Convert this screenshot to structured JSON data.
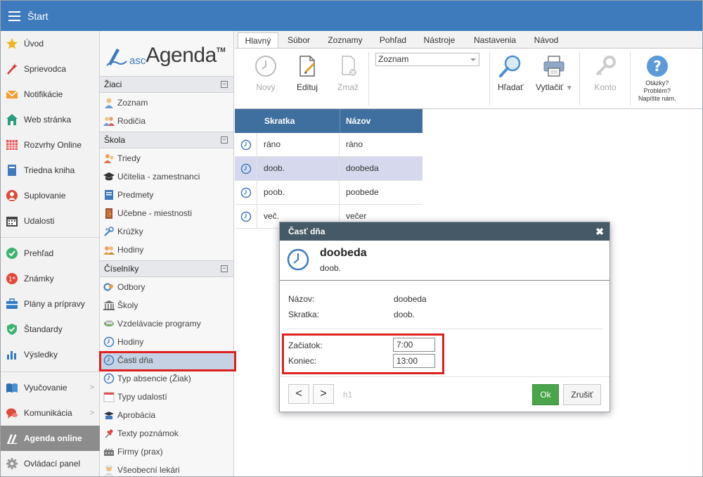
{
  "topbar": {
    "title": "Štart"
  },
  "leftnav": {
    "items": [
      {
        "label": "Úvod",
        "icon": "star-icon"
      },
      {
        "label": "Sprievodca",
        "icon": "wand-icon"
      },
      {
        "label": "Notifikácie",
        "icon": "envelope-icon"
      },
      {
        "label": "Web stránka",
        "icon": "house-icon"
      },
      {
        "label": "Rozvrhy Online",
        "icon": "timetable-icon"
      },
      {
        "label": "Triedna kniha",
        "icon": "book-icon"
      },
      {
        "label": "Suplovanie",
        "icon": "person-icon"
      },
      {
        "label": "Udalosti",
        "icon": "calendar-icon"
      },
      {
        "label": "Prehľad",
        "icon": "check-circle-icon"
      },
      {
        "label": "Známky",
        "icon": "grade-icon"
      },
      {
        "label": "Plány a prípravy",
        "icon": "briefcase-icon"
      },
      {
        "label": "Štandardy",
        "icon": "shield-icon"
      },
      {
        "label": "Výsledky",
        "icon": "bar-chart-icon"
      },
      {
        "label": "Vyučovanie",
        "icon": "open-book-icon"
      },
      {
        "label": "Komunikácia",
        "icon": "chat-icon"
      },
      {
        "label": "Agenda online",
        "icon": "agenda-icon"
      },
      {
        "label": "Ovládací panel",
        "icon": "gear-icon"
      }
    ]
  },
  "logo": {
    "asc": "asc",
    "agenda": "Agenda",
    "tm": "TM"
  },
  "tree": {
    "sections": [
      {
        "title": "Žiaci",
        "items": [
          {
            "label": "Zoznam",
            "icon": "student-icon"
          },
          {
            "label": "Rodičia",
            "icon": "parents-icon"
          }
        ]
      },
      {
        "title": "Škola",
        "items": [
          {
            "label": "Triedy",
            "icon": "class-icon"
          },
          {
            "label": "Učitelia - zamestnanci",
            "icon": "graduation-cap-icon"
          },
          {
            "label": "Predmety",
            "icon": "subject-icon"
          },
          {
            "label": "Učebne - miestnosti",
            "icon": "door-icon"
          },
          {
            "label": "Krúžky",
            "icon": "club-icon"
          },
          {
            "label": "Hodiny",
            "icon": "lessons-icon"
          }
        ]
      },
      {
        "title": "Číselníky",
        "items": [
          {
            "label": "Odbory",
            "icon": "fields-icon"
          },
          {
            "label": "Školy",
            "icon": "school-building-icon"
          },
          {
            "label": "Vzdelávacie programy",
            "icon": "program-icon"
          },
          {
            "label": "Hodiny",
            "icon": "clock-icon"
          },
          {
            "label": "Časti dňa",
            "icon": "clock-icon"
          },
          {
            "label": "Typ absencie (Žiak)",
            "icon": "clock-icon"
          },
          {
            "label": "Typy udalostí",
            "icon": "calendar-icon"
          },
          {
            "label": "Aprobácia",
            "icon": "qualification-icon"
          },
          {
            "label": "Texty poznámok",
            "icon": "pin-icon"
          },
          {
            "label": "Firmy (prax)",
            "icon": "company-icon"
          },
          {
            "label": "Všeobecní lekári",
            "icon": "doctor-icon"
          }
        ]
      }
    ],
    "collapse_symbol": "−"
  },
  "ribbon": {
    "tabs": [
      "Hlavný",
      "Súbor",
      "Zoznamy",
      "Pohľad",
      "Nástroje",
      "Nastavenia",
      "Návod"
    ],
    "new_label": "Nový",
    "edit_label": "Edituj",
    "delete_label": "Zmaž",
    "combo_value": "Zoznam",
    "search_label": "Hľadať",
    "print_label": "Vytlačiť",
    "account_label": "Konto",
    "help_line1": "Otázky?",
    "help_line2": "Problém?",
    "help_line3": "Napíšte nám."
  },
  "grid": {
    "headers": [
      "Skratka",
      "Názov"
    ],
    "rows": [
      {
        "skratka": "ráno",
        "nazov": "ráno"
      },
      {
        "skratka": "doob.",
        "nazov": "doobeda"
      },
      {
        "skratka": "poob.",
        "nazov": "poobede"
      },
      {
        "skratka": "več.",
        "nazov": "večer"
      }
    ]
  },
  "dialog": {
    "title": "Časť dňa",
    "close": "✖",
    "record_title": "doobeda",
    "record_sub": "doob.",
    "fields": {
      "nazov_label": "Názov:",
      "nazov_value": "doobeda",
      "skratka_label": "Skratka:",
      "skratka_value": "doob.",
      "zaciatok_label": "Začiatok:",
      "zaciatok_value": "7:00",
      "koniec_label": "Koniec:",
      "koniec_value": "13:00"
    },
    "prev": "<",
    "next": ">",
    "h1": "h1",
    "ok": "Ok",
    "cancel": "Zrušiť"
  },
  "colors": {
    "topbar": "#3d7bbd",
    "grid_header": "#3f6f9f",
    "dialog_header": "#455a66",
    "ok": "#4aa54a",
    "highlight": "#e02020"
  }
}
